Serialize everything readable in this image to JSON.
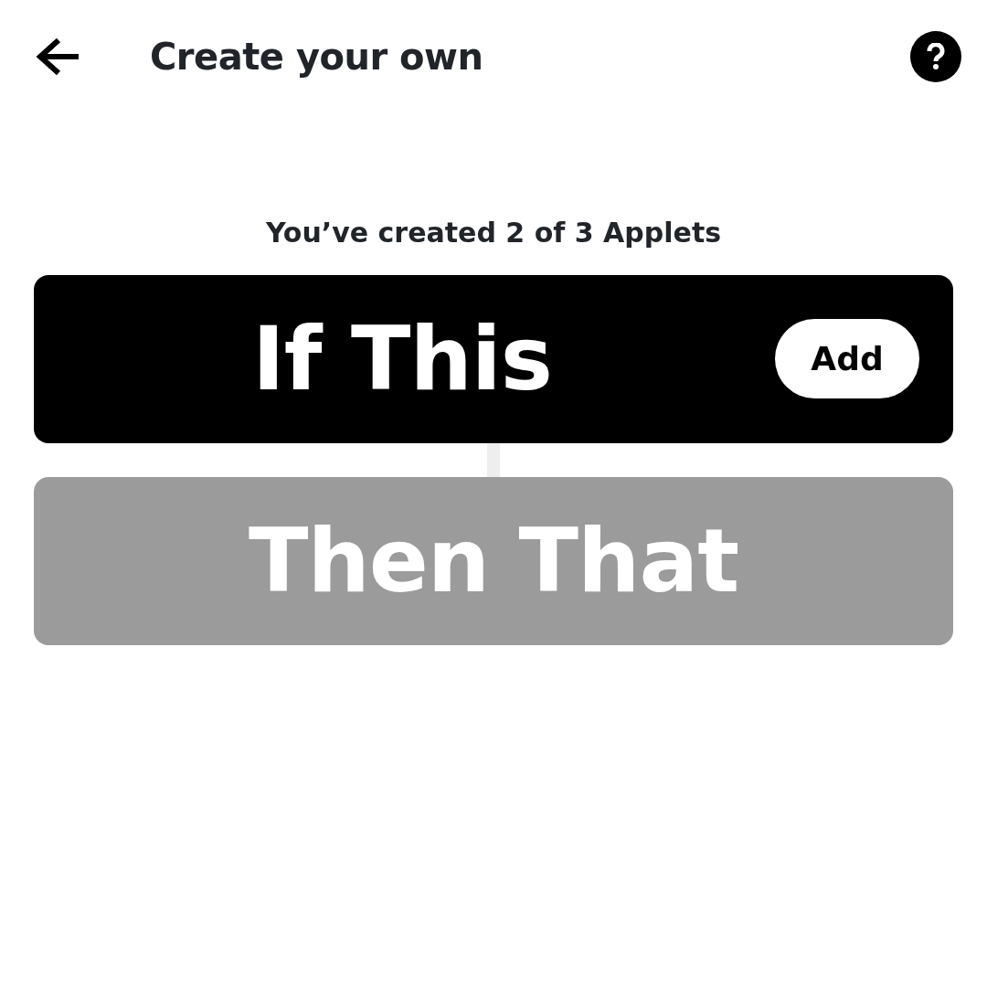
{
  "header": {
    "title": "Create your own"
  },
  "subtitle": "You’ve created 2 of 3 Applets",
  "steps": [
    {
      "label": "If This",
      "disabled": false,
      "button": "Add"
    },
    {
      "label": "Then That",
      "disabled": true
    }
  ]
}
